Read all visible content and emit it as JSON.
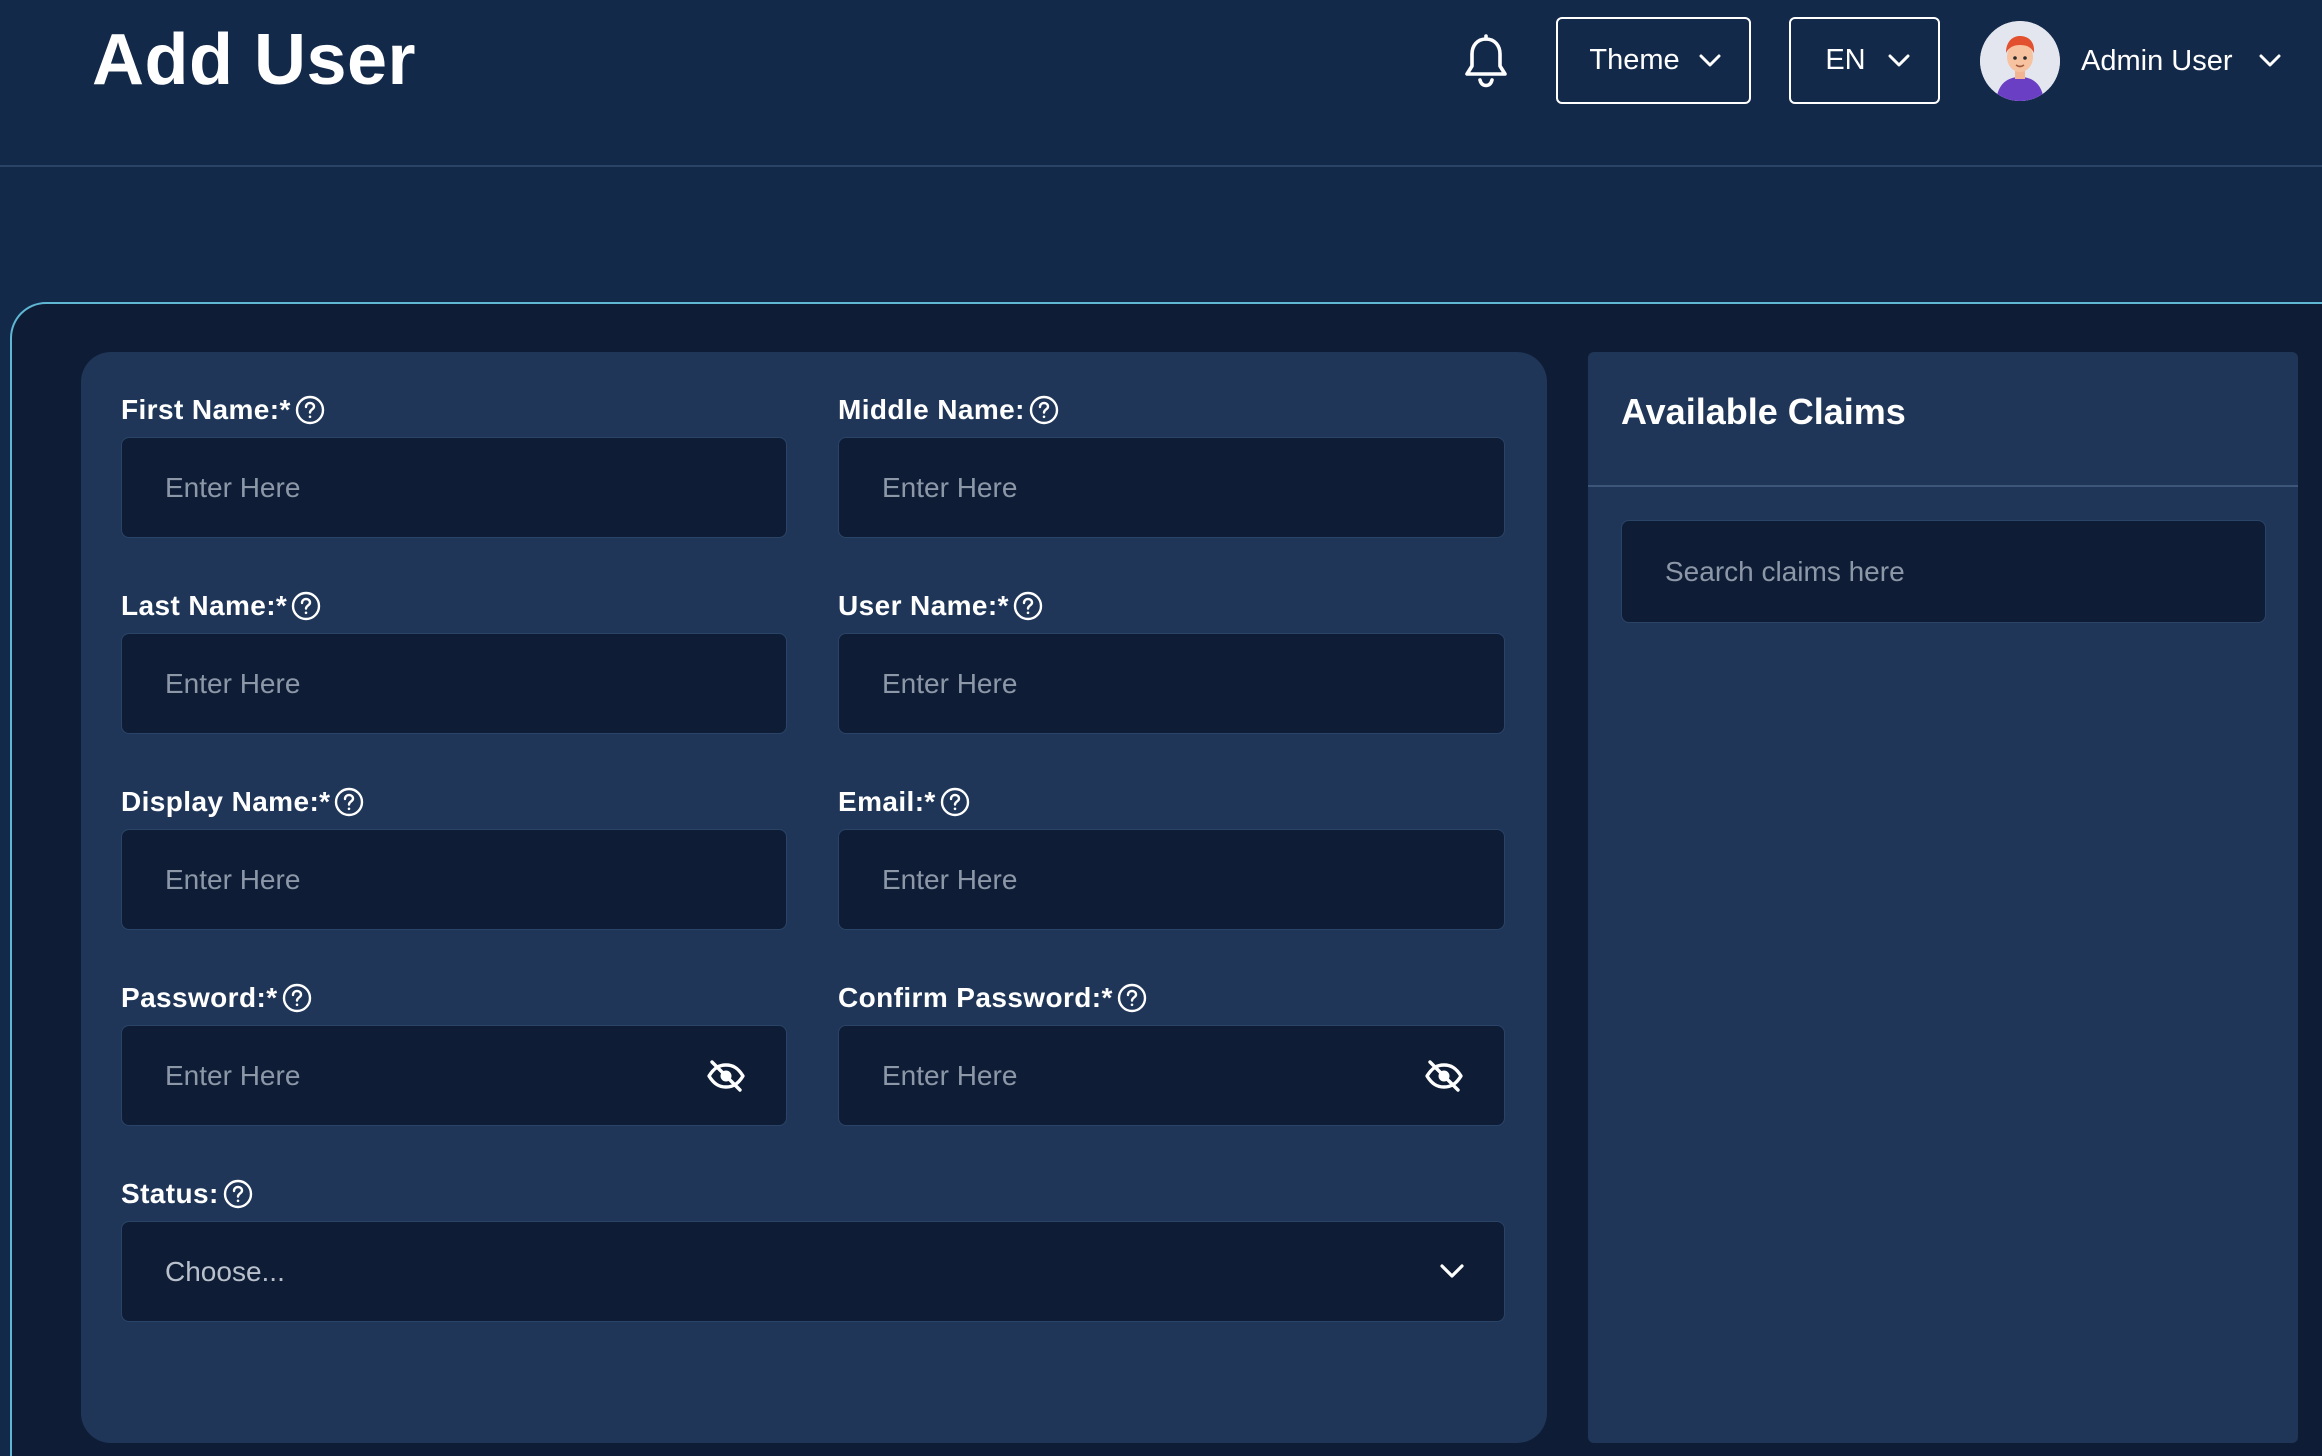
{
  "page": {
    "title": "Add User"
  },
  "header": {
    "theme_label": "Theme",
    "language_label": "EN",
    "user_name": "Admin User",
    "icons": [
      "bell-icon",
      "chevron-down-icon",
      "avatar"
    ]
  },
  "form": {
    "fields": [
      {
        "key": "first_name",
        "label": "First Name:*",
        "placeholder": "Enter Here"
      },
      {
        "key": "middle_name",
        "label": "Middle Name:",
        "placeholder": "Enter Here"
      },
      {
        "key": "last_name",
        "label": "Last Name:*",
        "placeholder": "Enter Here"
      },
      {
        "key": "user_name",
        "label": "User Name:*",
        "placeholder": "Enter Here"
      },
      {
        "key": "display_name",
        "label": "Display Name:*",
        "placeholder": "Enter Here"
      },
      {
        "key": "email",
        "label": "Email:*",
        "placeholder": "Enter Here"
      },
      {
        "key": "password",
        "label": "Password:*",
        "placeholder": "Enter Here"
      },
      {
        "key": "confirm_password",
        "label": "Confirm Password:*",
        "placeholder": "Enter Here"
      }
    ],
    "status": {
      "label": "Status:",
      "selected": "Choose..."
    }
  },
  "claims": {
    "title": "Available Claims",
    "search_placeholder": "Search claims here"
  },
  "colors": {
    "header_bg": "#13294a",
    "frame_bg": "#0e1d35",
    "panel_bg": "#1f3658",
    "input_bg": "#0e1d35",
    "accent_border": "#5fb7d4",
    "placeholder": "#8c97a8"
  }
}
